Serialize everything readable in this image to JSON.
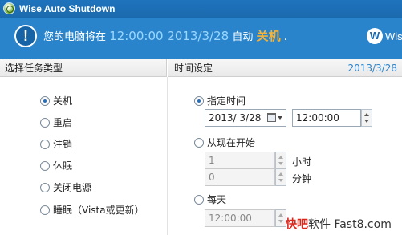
{
  "window": {
    "title": "Wise Auto Shutdown"
  },
  "banner": {
    "icon": "info-icon",
    "prefix": "您的电脑将在",
    "time": "12:00:00 2013/3/28",
    "mid": "自动",
    "action": "关机",
    "suffix": ".",
    "brand_letter": "W",
    "brand_text": "Wis"
  },
  "task_panel": {
    "header": "选择任务类型",
    "options": [
      "关机",
      "重启",
      "注销",
      "休眠",
      "关闭电源",
      "睡眠（Vista或更新）"
    ],
    "selected": "关机"
  },
  "time_panel": {
    "header": "时间设定",
    "header_date": "2013/3/28",
    "specified": {
      "label": "指定时间",
      "checked": true,
      "date_value": "2013/ 3/28",
      "time_value": "12:00:00"
    },
    "from_now": {
      "label": "从现在开始",
      "checked": false,
      "hours_value": "1",
      "hours_unit": "小时",
      "minutes_value": "0",
      "minutes_unit": "分钟"
    },
    "daily": {
      "label": "每天",
      "checked": false,
      "time_value": "12:00:00"
    }
  },
  "watermark": {
    "highlight": "快吧",
    "rest": "软件 Fast8.com"
  },
  "colors": {
    "title_bar": "#1b6aae",
    "banner": "#2a84cc",
    "time_text": "#9bd7ff",
    "action_text": "#f3b33b",
    "link_blue": "#2a84cc"
  }
}
